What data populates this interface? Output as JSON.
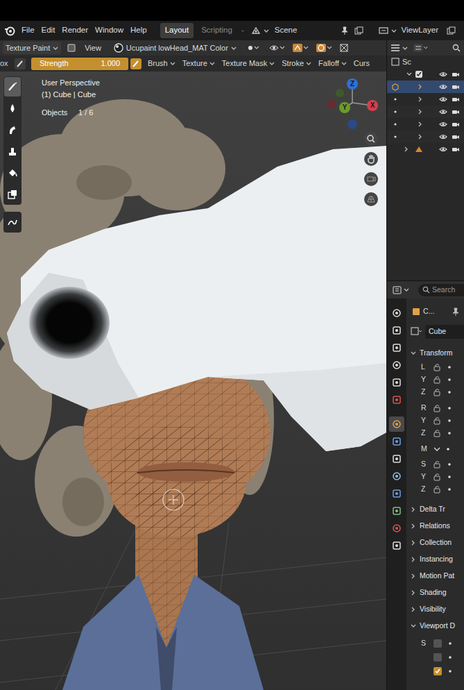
{
  "topbar": {
    "menus": [
      "File",
      "Edit",
      "Render",
      "Window",
      "Help"
    ],
    "workspaces": [
      {
        "label": "Layout",
        "selected": true
      },
      {
        "label": "Scripting",
        "selected": false
      }
    ],
    "workspace_more": "-",
    "scene": "Scene",
    "view_layer": "ViewLayer"
  },
  "header": {
    "mode": "Texture Paint",
    "view": "View",
    "material": "Ucupaint lowHead_MAT Color"
  },
  "tool_settings": {
    "cut": "ox",
    "strength": {
      "label": "Strength",
      "reading": "1.000",
      "level": 1
    },
    "menus": [
      "Brush",
      "Texture",
      "Texture Mask",
      "Stroke",
      "Falloff",
      "Curs"
    ]
  },
  "viewport": {
    "perspective": "User Perspective",
    "object": "(1) Cube | Cube",
    "objects_label": "Objects",
    "objects_count": "1 / 6",
    "axes": [
      {
        "label": "Z",
        "color": "#2f6fd6"
      },
      {
        "label": "Y",
        "color": "#6a9c2a"
      },
      {
        "label": "X",
        "color": "#d3404e"
      }
    ]
  },
  "tools": [
    {
      "selected": true
    },
    {
      "selected": false
    },
    {
      "selected": false
    },
    {
      "selected": false
    },
    {
      "selected": false
    },
    {
      "selected": false
    },
    {
      "selected": false
    }
  ],
  "outliner": {
    "root": "Sc",
    "rows": [
      {
        "kind": "collection",
        "expanded": true,
        "selected": false
      },
      {
        "kind": "object",
        "expanded": false,
        "selected": true
      },
      {
        "kind": "object",
        "expanded": false,
        "selected": false
      },
      {
        "kind": "object",
        "expanded": false,
        "selected": false
      },
      {
        "kind": "object",
        "expanded": false,
        "selected": false
      },
      {
        "kind": "object",
        "expanded": false,
        "selected": false
      },
      {
        "kind": "camera",
        "expanded": false,
        "selected": false
      }
    ]
  },
  "properties": {
    "search": "Search",
    "tabs": [
      {
        "selected": false
      },
      {
        "selected": false
      },
      {
        "selected": false
      },
      {
        "selected": false
      },
      {
        "selected": false
      },
      {
        "selected": false
      },
      {
        "selected": true
      },
      {
        "selected": false
      },
      {
        "selected": false
      },
      {
        "selected": false
      },
      {
        "selected": false
      },
      {
        "selected": false
      },
      {
        "selected": false
      },
      {
        "selected": false
      }
    ],
    "title": "C...",
    "object_name": "Cube",
    "transform": {
      "label": "Transform",
      "expanded": true,
      "rows": [
        {
          "label": "L",
          "kind": "lock"
        },
        {
          "label": "Y",
          "kind": "lock"
        },
        {
          "label": "Z",
          "kind": "lock"
        },
        {
          "label": "R",
          "kind": "lock"
        },
        {
          "label": "Y",
          "kind": "lock"
        },
        {
          "label": "Z",
          "kind": "lock"
        },
        {
          "label": "M",
          "kind": "mode"
        },
        {
          "label": "S",
          "kind": "lock"
        },
        {
          "label": "Y",
          "kind": "lock"
        },
        {
          "label": "Z",
          "kind": "lock"
        }
      ]
    },
    "sections": [
      {
        "label": "Delta Tr",
        "expanded": false
      },
      {
        "label": "Relations",
        "expanded": false
      },
      {
        "label": "Collection",
        "expanded": false
      },
      {
        "label": "Instancing",
        "expanded": false
      },
      {
        "label": "Motion Pat",
        "expanded": false
      },
      {
        "label": "Shading",
        "expanded": false
      },
      {
        "label": "Visibility",
        "expanded": false
      },
      {
        "label": "Viewport D",
        "expanded": true
      }
    ],
    "viewport_display": {
      "label": "S",
      "checks": [
        {
          "checked": false
        },
        {
          "checked": false
        },
        {
          "checked": true
        }
      ]
    }
  }
}
